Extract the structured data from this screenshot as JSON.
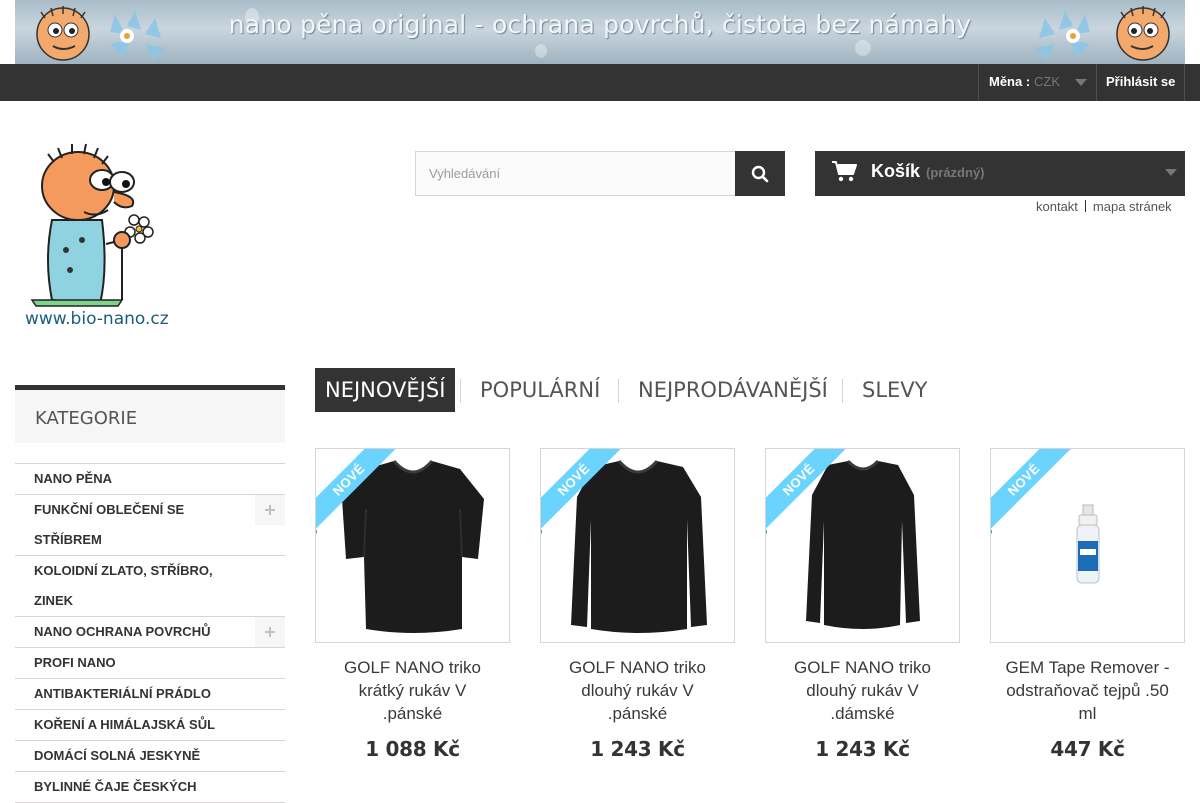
{
  "banner": {
    "text": "nano pěna original - ochrana povrchů, čistota bez námahy"
  },
  "topbar": {
    "currency_label": "Měna :",
    "currency_value": "CZK",
    "login_label": "Přihlásit se"
  },
  "logo": {
    "url_text": "www.bio-nano.cz"
  },
  "search": {
    "placeholder": "Vyhledávání",
    "icon": "search-icon"
  },
  "cart": {
    "title": "Košík",
    "status": "(prázdný)",
    "icon": "cart-icon"
  },
  "header_links": [
    "kontakt",
    "mapa stránek"
  ],
  "sidebar": {
    "title": "KATEGORIE",
    "items": [
      {
        "label": "NANO PĚNA",
        "expandable": false
      },
      {
        "label": "FUNKČNÍ OBLEČENÍ SE STŘÍBREM",
        "expandable": true
      },
      {
        "label": "KOLOIDNÍ ZLATO, STŘÍBRO, ZINEK",
        "expandable": false
      },
      {
        "label": "NANO OCHRANA POVRCHŮ",
        "expandable": true
      },
      {
        "label": "PROFI NANO",
        "expandable": false
      },
      {
        "label": "ANTIBAKTERIÁLNÍ PRÁDLO",
        "expandable": false
      },
      {
        "label": "KOŘENÍ A HIMÁLAJSKÁ SŮL",
        "expandable": false
      },
      {
        "label": "DOMÁCÍ SOLNÁ JESKYNĚ",
        "expandable": false
      },
      {
        "label": "BYLINNÉ ČAJE ČESKÝCH",
        "expandable": false
      }
    ]
  },
  "tabs": [
    {
      "label": "NEJNOVĚJŠÍ",
      "active": true
    },
    {
      "label": "POPULÁRNÍ",
      "active": false
    },
    {
      "label": "NEJPRODÁVANĚJŠÍ",
      "active": false
    },
    {
      "label": "SLEVY",
      "active": false
    }
  ],
  "colors": {
    "dark": "#333333",
    "ribbon": "#6ad4ff",
    "border": "#d6d4d4"
  },
  "products": [
    {
      "badge": "NOVÉ",
      "name": "GOLF NANO triko krátký rukáv V .pánské",
      "price": "1 088 Kč",
      "image": "short-sleeve-tshirt"
    },
    {
      "badge": "NOVÉ",
      "name": "GOLF NANO triko dlouhý rukáv V .pánské",
      "price": "1 243 Kč",
      "image": "long-sleeve-tshirt"
    },
    {
      "badge": "NOVÉ",
      "name": "GOLF NANO triko dlouhý rukáv V .dámské",
      "price": "1 243 Kč",
      "image": "long-sleeve-tshirt-women"
    },
    {
      "badge": "NOVÉ",
      "name": "GEM Tape Remover - odstraňovač tejpů .50 ml",
      "price": "447 Kč",
      "image": "spray-bottle"
    }
  ]
}
